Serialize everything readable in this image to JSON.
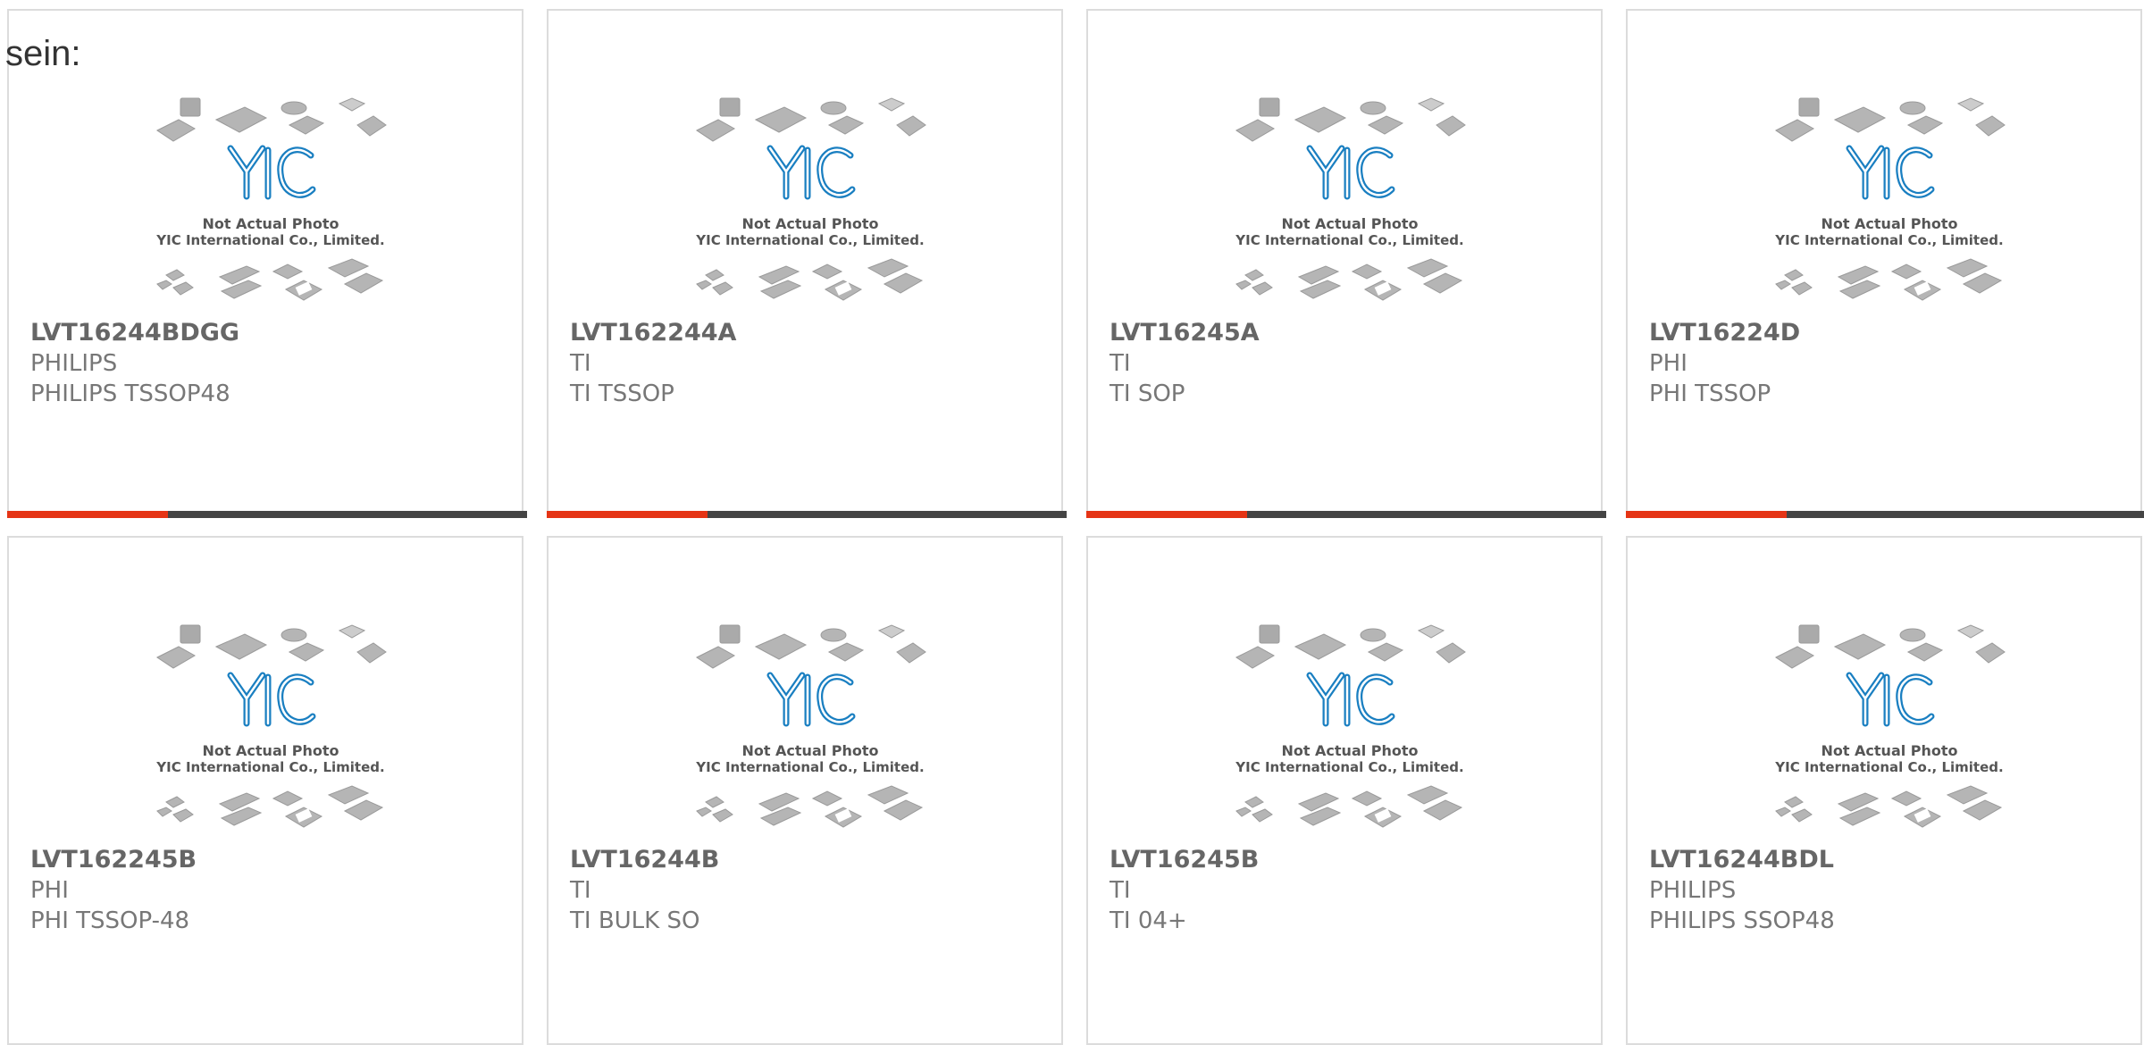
{
  "page": {
    "intro_text": "sein:"
  },
  "placeholder_image": {
    "line1": "Not Actual Photo",
    "line2": "YIC International Co., Limited.",
    "logo_text": "YIC"
  },
  "colors": {
    "accent": "#e53415",
    "bar": "#444444",
    "logo": "#1a7fc1"
  },
  "products": [
    {
      "part_number": "LVT16244BDGG",
      "manufacturer": "PHILIPS",
      "package": "PHILIPS TSSOP48",
      "progress": 0.31
    },
    {
      "part_number": "LVT162244A",
      "manufacturer": "TI",
      "package": "TI TSSOP",
      "progress": 0.31
    },
    {
      "part_number": "LVT16245A",
      "manufacturer": "TI",
      "package": "TI SOP",
      "progress": 0.31
    },
    {
      "part_number": "LVT16224D",
      "manufacturer": "PHI",
      "package": "PHI TSSOP",
      "progress": 0.31
    },
    {
      "part_number": "LVT162245B",
      "manufacturer": "PHI",
      "package": "PHI TSSOP-48",
      "progress": 0
    },
    {
      "part_number": "LVT16244B",
      "manufacturer": "TI",
      "package": "TI BULK SO",
      "progress": 0
    },
    {
      "part_number": "LVT16245B",
      "manufacturer": "TI",
      "package": "TI 04+",
      "progress": 0
    },
    {
      "part_number": "LVT16244BDL",
      "manufacturer": "PHILIPS",
      "package": "PHILIPS SSOP48",
      "progress": 0
    }
  ]
}
